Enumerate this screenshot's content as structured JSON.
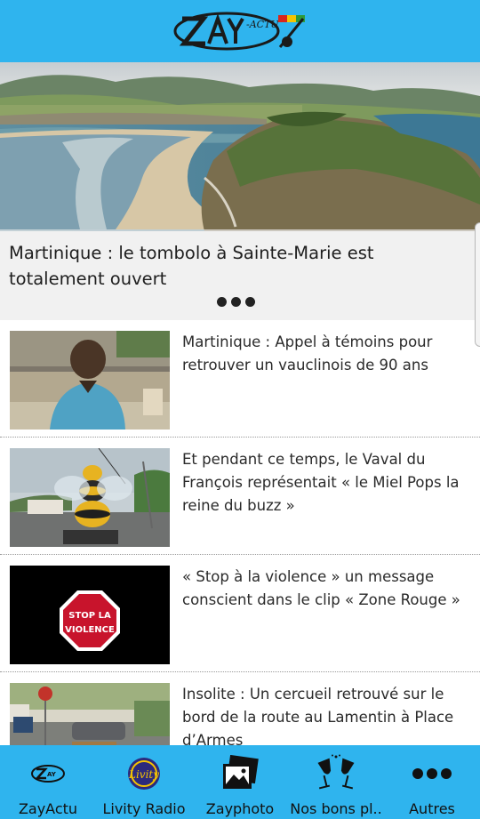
{
  "header": {
    "logo_text": "ZAY-ACTU",
    "brand_color": "#2fb4ee"
  },
  "hero": {
    "title": "Martinique : le tombolo à Sainte-Marie est totalement ouvert",
    "pager_dots": 3
  },
  "articles": [
    {
      "title": "Martinique : Appel à témoins pour retrouver un vauclinois de 90 ans",
      "thumb": "elderly-man-photo"
    },
    {
      "title": "Et pendant ce temps, le Vaval du François représentait « le Miel Pops la reine du buzz »",
      "thumb": "bee-carnival-photo"
    },
    {
      "title": "« Stop à la violence » un message conscient dans le clip « Zone Rouge »",
      "thumb": "stop-violence-sign",
      "thumb_text": "STOP LA VIOLENCE"
    },
    {
      "title": "Insolite : Un cercueil retrouvé sur le bord de la route au Lamentin à Place d’Armes",
      "thumb": "roadside-coffin-photo"
    }
  ],
  "bottom_nav": [
    {
      "label": "ZayActu",
      "icon": "zayactu-logo-icon"
    },
    {
      "label": "Livity Radio",
      "icon": "livity-radio-icon",
      "icon_text": "Livity"
    },
    {
      "label": "Zayphoto",
      "icon": "photos-icon"
    },
    {
      "label": "Nos bons pl..",
      "icon": "cheers-glasses-icon"
    },
    {
      "label": "Autres",
      "icon": "more-dots-icon"
    }
  ]
}
